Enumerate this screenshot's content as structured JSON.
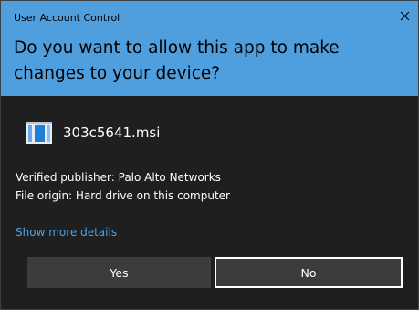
{
  "window": {
    "title": "User Account Control",
    "close_icon": "close-icon"
  },
  "header": {
    "question": "Do you want to allow this app to make changes to your device?",
    "background_color": "#4f9fdf"
  },
  "app": {
    "file_name": "303c5641.msi",
    "icon": "installer-package-icon"
  },
  "info": {
    "publisher": "Verified publisher: Palo Alto Networks",
    "origin": "File origin: Hard drive on this computer"
  },
  "links": {
    "details": "Show more details"
  },
  "buttons": {
    "yes": "Yes",
    "no": "No"
  },
  "colors": {
    "body_background": "#1f1f1f",
    "link": "#4aa3e8",
    "button_background": "#3c3c3c"
  }
}
